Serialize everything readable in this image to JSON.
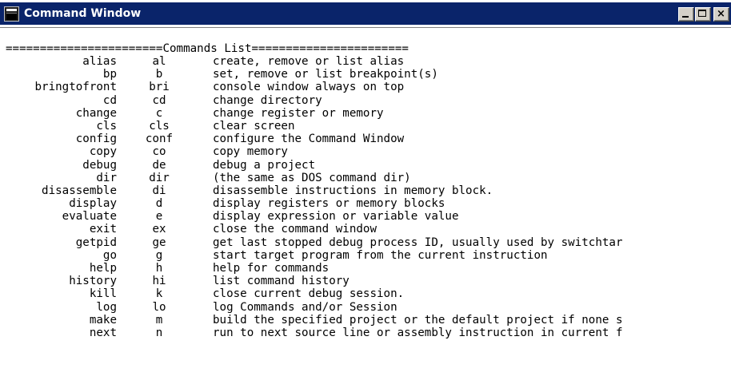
{
  "window": {
    "title": "Command Window",
    "controls": {
      "minimize_icon": "minimize-icon",
      "maximize_icon": "maximize-icon",
      "close_icon": "close-icon"
    }
  },
  "console": {
    "header": "=======================Commands List=======================",
    "commands": [
      {
        "name": "alias",
        "abbr": "al",
        "desc": "create, remove or list alias"
      },
      {
        "name": "bp",
        "abbr": "b",
        "desc": "set, remove or list breakpoint(s)"
      },
      {
        "name": "bringtofront",
        "abbr": "bri",
        "desc": "console window always on top"
      },
      {
        "name": "cd",
        "abbr": "cd",
        "desc": "change directory"
      },
      {
        "name": "change",
        "abbr": "c",
        "desc": "change register or memory"
      },
      {
        "name": "cls",
        "abbr": "cls",
        "desc": "clear screen"
      },
      {
        "name": "config",
        "abbr": "conf",
        "desc": "configure the Command Window"
      },
      {
        "name": "copy",
        "abbr": "co",
        "desc": "copy memory"
      },
      {
        "name": "debug",
        "abbr": "de",
        "desc": "debug a project"
      },
      {
        "name": "dir",
        "abbr": "dir",
        "desc": "(the same as DOS command dir)"
      },
      {
        "name": "disassemble",
        "abbr": "di",
        "desc": "disassemble instructions in memory block."
      },
      {
        "name": "display",
        "abbr": "d",
        "desc": "display registers or memory blocks"
      },
      {
        "name": "evaluate",
        "abbr": "e",
        "desc": "display expression or variable value"
      },
      {
        "name": "exit",
        "abbr": "ex",
        "desc": "close the command window"
      },
      {
        "name": "getpid",
        "abbr": "ge",
        "desc": "get last stopped debug process ID, usually used by switchtar"
      },
      {
        "name": "go",
        "abbr": "g",
        "desc": "start target program from the current instruction"
      },
      {
        "name": "help",
        "abbr": "h",
        "desc": "help for commands"
      },
      {
        "name": "history",
        "abbr": "hi",
        "desc": "list command history"
      },
      {
        "name": "kill",
        "abbr": "k",
        "desc": "close current debug session."
      },
      {
        "name": "log",
        "abbr": "lo",
        "desc": "log Commands and/or Session"
      },
      {
        "name": "make",
        "abbr": "m",
        "desc": "build the specified project or the default project if none s"
      },
      {
        "name": "next",
        "abbr": "n",
        "desc": "run to next source line or assembly instruction in current f"
      }
    ]
  }
}
